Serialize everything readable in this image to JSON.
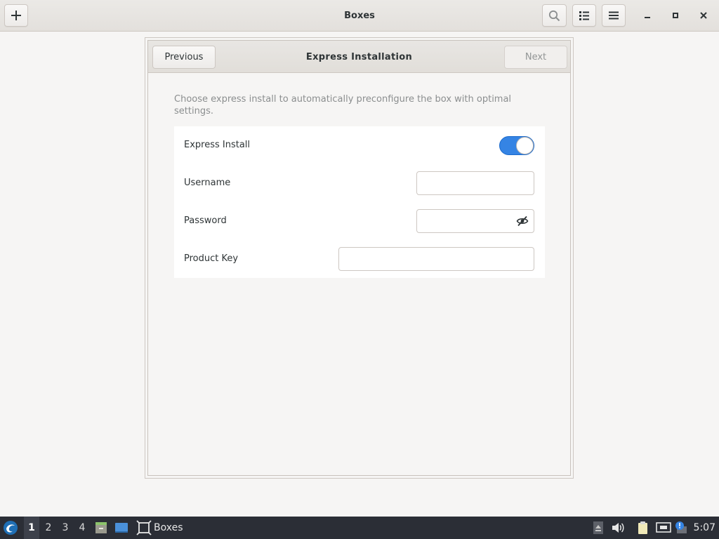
{
  "app": {
    "title": "Boxes"
  },
  "dialog": {
    "title": "Express Installation",
    "previous_label": "Previous",
    "next_label": "Next",
    "description": "Choose express install to automatically preconfigure the box with optimal settings."
  },
  "form": {
    "express_install_label": "Express Install",
    "express_install_on": true,
    "username_label": "Username",
    "username_value": "",
    "password_label": "Password",
    "password_value": "",
    "product_key_label": "Product Key",
    "product_key_value": ""
  },
  "taskbar": {
    "workspaces": [
      "1",
      "2",
      "3",
      "4"
    ],
    "active_workspace": "1",
    "task_label": "Boxes",
    "clock": "5:07"
  },
  "colors": {
    "accent": "#3584e4",
    "taskbar_bg": "#2b2e36"
  }
}
